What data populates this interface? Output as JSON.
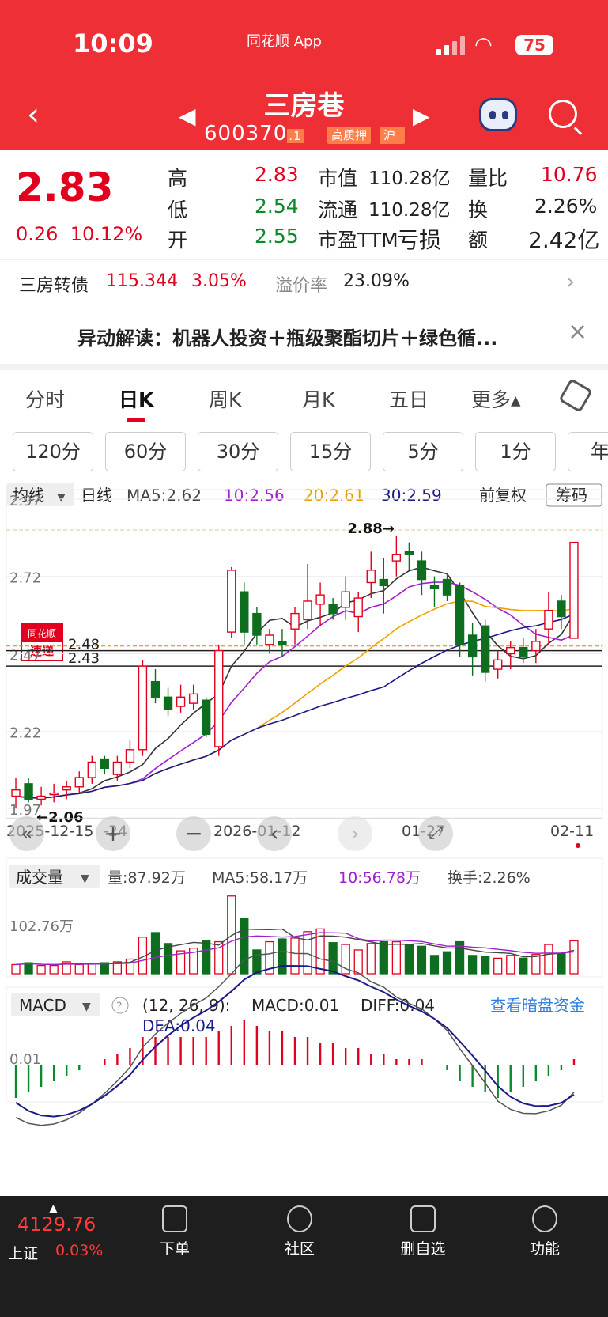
{
  "status": {
    "time": "10:09",
    "app": "同花顺 App",
    "battery": "75"
  },
  "header": {
    "title": "三房巷",
    "code": "600370",
    "code_suffix": ".1",
    "tag1": "高质押",
    "tag2": "沪股"
  },
  "quote": {
    "price": "2.83",
    "change": "0.26",
    "change_pct": "10.12%",
    "high_label": "高",
    "high": "2.83",
    "low_label": "低",
    "low": "2.54",
    "open_label": "开",
    "open": "2.55",
    "mcap_label": "市值",
    "mcap": "110.28亿",
    "float_label": "流通",
    "float": "110.28亿",
    "pe_label": "市盈TTM",
    "pe": "亏损",
    "vr_label": "量比",
    "vr": "10.76",
    "turn_label": "换",
    "turn": "2.26%",
    "amt_label": "额",
    "amt": "2.42亿"
  },
  "bond": {
    "name": "三房转债",
    "price": "115.344",
    "pct": "3.05%",
    "premium_label": "溢价率",
    "premium": "23.09%"
  },
  "news": {
    "logo_top": "同花顺",
    "logo_bottom": "速递",
    "text": "异动解读：机器人投资＋瓶级聚酯切片＋绿色循..."
  },
  "tabs": [
    "分时",
    "日K",
    "周K",
    "月K",
    "五日",
    "更多▴"
  ],
  "periods": [
    "120分",
    "60分",
    "30分",
    "15分",
    "5分",
    "1分",
    "年"
  ],
  "kline_header": {
    "indicator": "均线",
    "period": "日线",
    "ma5": "MA5:2.62",
    "ma10": "10:2.56",
    "ma20": "20:2.61",
    "ma30": "30:2.59",
    "adjust": "前复权",
    "chip": "筹码"
  },
  "kline_axis": {
    "y": [
      "2.97",
      "2.72",
      "2.47",
      "2.22",
      "1.97"
    ],
    "x": [
      "2025-12-15",
      "-24",
      "2026-01-12",
      "01-27",
      "02-11"
    ],
    "lines": [
      "2.48",
      "2.43"
    ],
    "max_label": "2.88→",
    "min_label": "←2.06"
  },
  "volume": {
    "label": "成交量",
    "vol": "量:87.92万",
    "ma5": "MA5:58.17万",
    "ma10": "10:56.78万",
    "turn": "换手:2.26%",
    "axis": "102.76万"
  },
  "macd": {
    "label": "MACD",
    "params": "(12, 26, 9):",
    "macd": "MACD:0.01",
    "diff": "DIFF:0.04",
    "dea": "DEA:0.04",
    "axis": "0.01",
    "link": "查看暗盘资金"
  },
  "toolbar": {
    "index_value": "4129.76",
    "index_name": "上证",
    "index_pct": "0.03%",
    "items": [
      "下单",
      "社区",
      "删自选",
      "功能"
    ]
  },
  "chart_data": {
    "type": "candlestick",
    "candles": [
      [
        2.03,
        2.01,
        2.07,
        1.97,
        "up"
      ],
      [
        2.05,
        2.0,
        2.07,
        1.99,
        "down"
      ],
      [
        2.01,
        2.0,
        2.04,
        1.98,
        "up"
      ],
      [
        2.02,
        2.02,
        2.05,
        1.99,
        "up"
      ],
      [
        2.03,
        2.04,
        2.06,
        2.0,
        "up"
      ],
      [
        2.07,
        2.04,
        2.09,
        2.02,
        "up"
      ],
      [
        2.12,
        2.07,
        2.14,
        2.05,
        "up"
      ],
      [
        2.1,
        2.13,
        2.14,
        2.08,
        "down"
      ],
      [
        2.12,
        2.08,
        2.14,
        2.06,
        "up"
      ],
      [
        2.16,
        2.12,
        2.19,
        2.1,
        "up"
      ],
      [
        2.43,
        2.16,
        2.45,
        2.14,
        "up"
      ],
      [
        2.38,
        2.33,
        2.42,
        2.31,
        "down"
      ],
      [
        2.33,
        2.29,
        2.36,
        2.27,
        "down"
      ],
      [
        2.33,
        2.3,
        2.37,
        2.28,
        "up"
      ],
      [
        2.34,
        2.31,
        2.37,
        2.29,
        "up"
      ],
      [
        2.21,
        2.32,
        2.33,
        2.2,
        "down"
      ],
      [
        2.17,
        2.48,
        2.5,
        2.14,
        "up"
      ],
      [
        2.54,
        2.74,
        2.75,
        2.52,
        "up"
      ],
      [
        2.67,
        2.54,
        2.7,
        2.5,
        "down"
      ],
      [
        2.53,
        2.6,
        2.62,
        2.5,
        "down"
      ],
      [
        2.5,
        2.53,
        2.55,
        2.47,
        "up"
      ],
      [
        2.5,
        2.51,
        2.55,
        2.46,
        "down"
      ],
      [
        2.55,
        2.6,
        2.62,
        2.5,
        "up"
      ],
      [
        2.58,
        2.64,
        2.76,
        2.55,
        "up"
      ],
      [
        2.63,
        2.66,
        2.7,
        2.56,
        "up"
      ],
      [
        2.63,
        2.6,
        2.65,
        2.58,
        "down"
      ],
      [
        2.62,
        2.67,
        2.72,
        2.58,
        "up"
      ],
      [
        2.59,
        2.65,
        2.67,
        2.54,
        "up"
      ],
      [
        2.7,
        2.74,
        2.8,
        2.65,
        "up"
      ],
      [
        2.69,
        2.71,
        2.78,
        2.6,
        "down"
      ],
      [
        2.77,
        2.79,
        2.85,
        2.72,
        "up"
      ],
      [
        2.79,
        2.8,
        2.83,
        2.74,
        "down"
      ],
      [
        2.77,
        2.71,
        2.8,
        2.66,
        "down"
      ],
      [
        2.69,
        2.68,
        2.72,
        2.62,
        "down"
      ],
      [
        2.71,
        2.66,
        2.73,
        2.64,
        "down"
      ],
      [
        2.69,
        2.5,
        2.7,
        2.46,
        "down"
      ],
      [
        2.53,
        2.46,
        2.57,
        2.4,
        "down"
      ],
      [
        2.56,
        2.41,
        2.58,
        2.38,
        "down"
      ],
      [
        2.42,
        2.45,
        2.48,
        2.39,
        "up"
      ],
      [
        2.47,
        2.49,
        2.51,
        2.42,
        "up"
      ],
      [
        2.49,
        2.46,
        2.52,
        2.44,
        "down"
      ],
      [
        2.48,
        2.51,
        2.55,
        2.44,
        "up"
      ],
      [
        2.55,
        2.61,
        2.67,
        2.5,
        "up"
      ],
      [
        2.64,
        2.59,
        2.66,
        2.55,
        "down"
      ],
      [
        2.52,
        2.83,
        2.83,
        2.52,
        "up"
      ]
    ],
    "volume": [
      10,
      12,
      9,
      9,
      13,
      10,
      11,
      12,
      13,
      16,
      40,
      45,
      33,
      25,
      28,
      36,
      35,
      85,
      60,
      26,
      35,
      38,
      39,
      46,
      49,
      34,
      32,
      26,
      33,
      35,
      35,
      32,
      30,
      20,
      24,
      35,
      20,
      19,
      17,
      20,
      17,
      21,
      32,
      22,
      36
    ],
    "macd_bars": [
      -0.06,
      -0.05,
      -0.04,
      -0.03,
      -0.02,
      -0.01,
      0,
      0.01,
      0.02,
      0.03,
      0.05,
      0.05,
      0.05,
      0.05,
      0.05,
      0.05,
      0.06,
      0.07,
      0.08,
      0.07,
      0.06,
      0.06,
      0.05,
      0.05,
      0.04,
      0.04,
      0.03,
      0.03,
      0.02,
      0.02,
      0.01,
      0.01,
      0.01,
      0,
      -0.01,
      -0.03,
      -0.04,
      -0.05,
      -0.06,
      -0.05,
      -0.04,
      -0.03,
      -0.02,
      -0.01,
      0.01
    ]
  }
}
